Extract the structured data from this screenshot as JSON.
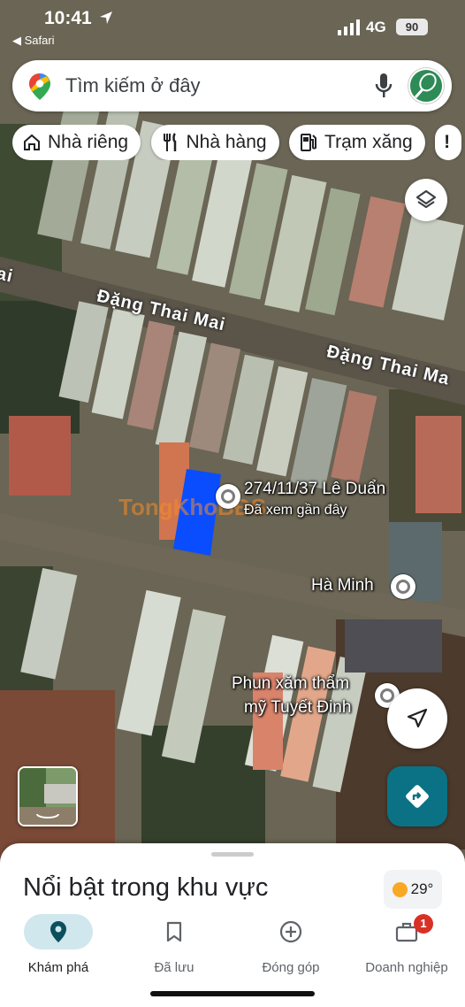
{
  "status_bar": {
    "time": "10:41",
    "back_app": "◀ Safari",
    "network": "4G",
    "battery": "90"
  },
  "search": {
    "placeholder": "Tìm kiếm ở đây",
    "icons": [
      "maps-pin-icon",
      "mic-icon",
      "avatar"
    ]
  },
  "chips": [
    {
      "label": "Nhà riêng",
      "icon": "home-icon"
    },
    {
      "label": "Nhà hàng",
      "icon": "restaurant-icon"
    },
    {
      "label": "Trạm xăng",
      "icon": "gas-station-icon"
    }
  ],
  "map": {
    "street_names": [
      "Đặng Thai Mai",
      "Đặng Thai Ma",
      "ai"
    ],
    "selected_place": {
      "name": "274/11/37 Lê Duẩn",
      "subtitle": "Đã xem gần đây",
      "highlight_color": "#0a4dff"
    },
    "pois": [
      {
        "name": "Hà Minh"
      },
      {
        "name_line1": "Phun xăm thẩm",
        "name_line2": "mỹ Tuyết Đinh"
      }
    ],
    "watermark": "TongKhoBĐS"
  },
  "sheet": {
    "heading": "Nổi bật trong khu vực",
    "weather": "29°"
  },
  "bottom_nav": [
    {
      "label": "Khám phá",
      "icon": "explore-pin-icon",
      "active": true
    },
    {
      "label": "Đã lưu",
      "icon": "bookmark-icon",
      "active": false
    },
    {
      "label": "Đóng góp",
      "icon": "add-circle-icon",
      "active": false
    },
    {
      "label": "Doanh nghiệp",
      "icon": "business-icon",
      "active": false,
      "badge": "1"
    }
  ],
  "colors": {
    "accent": "#0b7285",
    "active_nav": "#cfe7ed",
    "badge": "#d93025"
  }
}
